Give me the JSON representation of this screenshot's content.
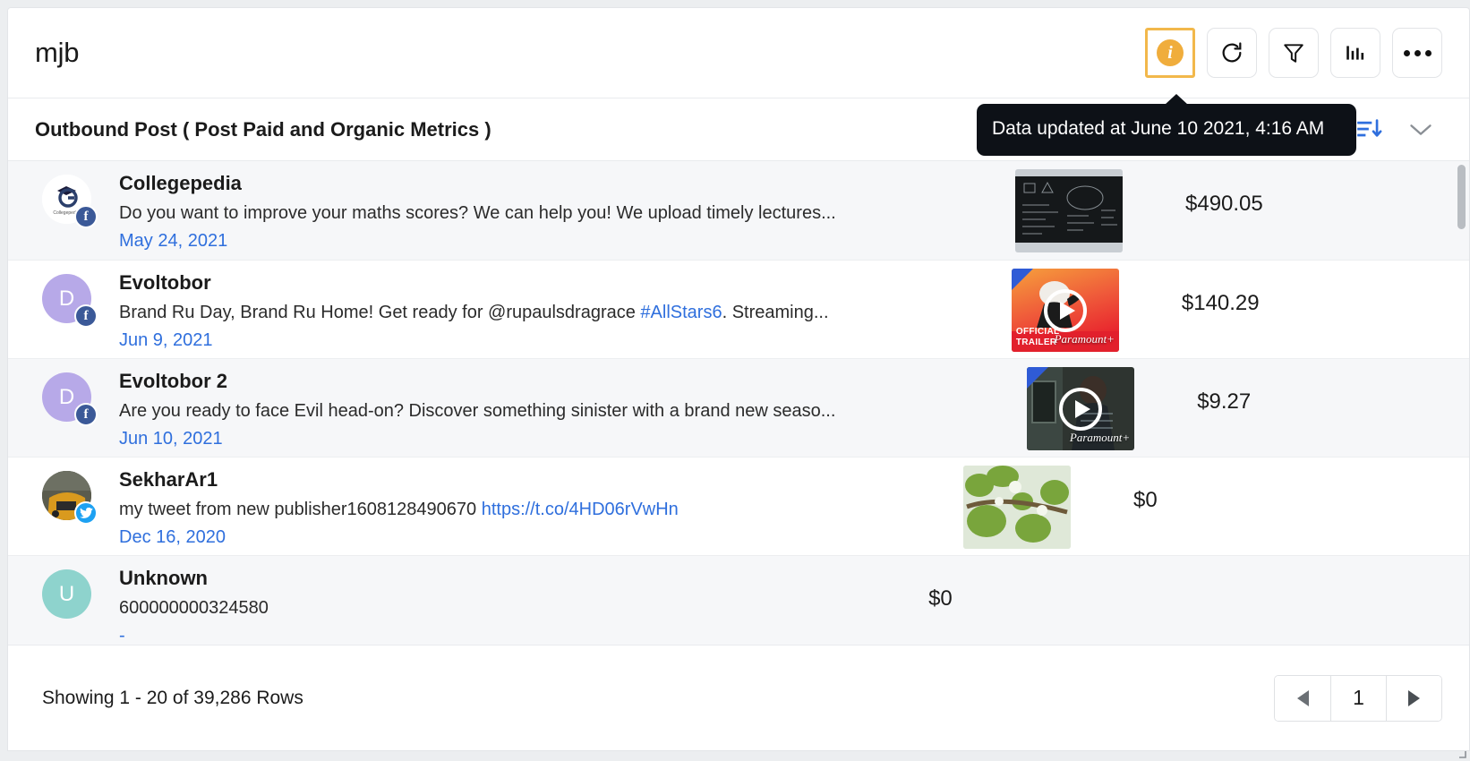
{
  "header": {
    "title": "mjb",
    "actions": [
      {
        "name": "info-button",
        "icon": "info-icon",
        "label": "i",
        "active": true
      },
      {
        "name": "refresh-button",
        "icon": "refresh-icon",
        "label": "",
        "active": false
      },
      {
        "name": "filter-button",
        "icon": "filter-icon",
        "label": "",
        "active": false
      },
      {
        "name": "chart-button",
        "icon": "bar-chart-icon",
        "label": "",
        "active": false
      },
      {
        "name": "more-button",
        "icon": "ellipsis-icon",
        "label": "",
        "active": false
      }
    ]
  },
  "tooltip": {
    "text": "Data updated at June 10 2021, 4:16 AM"
  },
  "sub_header": {
    "title": "Outbound Post ( Post Paid and Organic Metrics )",
    "sort_icon": "sort-descending-icon",
    "chevron_icon": "chevron-down-icon"
  },
  "rows": [
    {
      "name": "Collegepedia",
      "message": "Do you want to improve your maths scores? We can help you! We upload timely lectures...",
      "link_text": "",
      "message_tail": "",
      "date": "May 24, 2021",
      "value": "$490.05",
      "network": "facebook",
      "avatar_type": "image-logo",
      "avatar_letter": "",
      "thumb": "blackboard-math",
      "has_play": false,
      "thumb_caption": ""
    },
    {
      "name": "Evoltobor",
      "message": "Brand Ru Day, Brand Ru Home! Get ready for @rupaulsdragrace ",
      "link_text": "#AllStars6",
      "message_tail": ". Streaming...",
      "date": "Jun 9, 2021",
      "value": "$140.29",
      "network": "facebook",
      "avatar_type": "letter",
      "avatar_letter": "D",
      "thumb": "drag-race-trailer",
      "has_play": true,
      "thumb_caption": "OFFICIAL TRAILER"
    },
    {
      "name": "Evoltobor 2",
      "message": "Are you ready to face Evil head-on? Discover something sinister with a brand new seaso...",
      "link_text": "",
      "message_tail": "",
      "date": "Jun 10, 2021",
      "value": "$9.27",
      "network": "facebook",
      "avatar_type": "letter",
      "avatar_letter": "D",
      "thumb": "evil-series",
      "has_play": true,
      "thumb_caption": ""
    },
    {
      "name": "SekharAr1",
      "message": "my tweet from new publisher1608128490670 ",
      "link_text": "https://t.co/4HD06rVwHn",
      "message_tail": "",
      "date": "Dec 16, 2020",
      "value": "$0",
      "network": "twitter",
      "avatar_type": "photo",
      "avatar_letter": "",
      "thumb": "tree-branch",
      "has_play": false,
      "thumb_caption": ""
    },
    {
      "name": "Unknown",
      "message": "600000000324580",
      "link_text": "",
      "message_tail": "",
      "date": "-",
      "value": "$0",
      "network": "none",
      "avatar_type": "letter",
      "avatar_letter": "U",
      "thumb": "none",
      "has_play": false,
      "thumb_caption": ""
    }
  ],
  "footer": {
    "showing": "Showing 1 - 20 of 39,286 Rows",
    "prev_label": "",
    "page_value": "1",
    "next_label": ""
  },
  "colors": {
    "accent_orange": "#f0ad3c",
    "link_blue": "#2f6fdd",
    "facebook": "#3b5998",
    "twitter": "#1da1f2",
    "tooltip_bg": "#0d1117",
    "row_alt": "#f6f7f9"
  }
}
